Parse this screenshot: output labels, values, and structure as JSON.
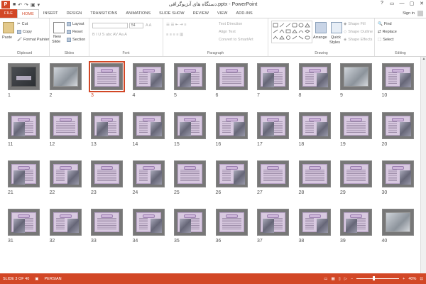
{
  "window": {
    "title": "دستگاه های آنژیوگرافی.pptx - PowerPoint",
    "app_badge": "P",
    "controls": [
      "?",
      "▭",
      "—",
      "▢",
      "✕"
    ]
  },
  "tabs": [
    {
      "label": "FILE"
    },
    {
      "label": "HOME"
    },
    {
      "label": "INSERT"
    },
    {
      "label": "DESIGN"
    },
    {
      "label": "TRANSITIONS"
    },
    {
      "label": "ANIMATIONS"
    },
    {
      "label": "SLIDE SHOW"
    },
    {
      "label": "REVIEW"
    },
    {
      "label": "VIEW"
    },
    {
      "label": "ADD-INS"
    }
  ],
  "signin": "Sign in",
  "ribbon": {
    "clipboard": {
      "label": "Clipboard",
      "paste": "Paste",
      "cut": "Cut",
      "copy": "Copy",
      "format_painter": "Format Painter"
    },
    "slides": {
      "label": "Slides",
      "new_slide": "New",
      "new_slide2": "Slide",
      "layout": "Layout",
      "reset": "Reset",
      "section": "Section"
    },
    "font": {
      "label": "Font",
      "size": "54"
    },
    "paragraph": {
      "label": "Paragraph",
      "text_direction": "Text Direction",
      "align_text": "Align Text",
      "smartart": "Convert to SmartArt"
    },
    "drawing": {
      "label": "Drawing",
      "arrange": "Arrange",
      "quick_styles": "Quick",
      "quick_styles2": "Styles",
      "shape_fill": "Shape Fill",
      "shape_outline": "Shape Outline",
      "shape_effects": "Shape Effects"
    },
    "editing": {
      "label": "Editing",
      "find": "Find",
      "replace": "Replace",
      "select": "Select"
    }
  },
  "slides": [
    {
      "n": "1",
      "kind": "title"
    },
    {
      "n": "2",
      "kind": "photo"
    },
    {
      "n": "3",
      "kind": "text",
      "selected": true
    },
    {
      "n": "4",
      "kind": "pic"
    },
    {
      "n": "5",
      "kind": "pic"
    },
    {
      "n": "6",
      "kind": "text"
    },
    {
      "n": "7",
      "kind": "pic"
    },
    {
      "n": "8",
      "kind": "pic"
    },
    {
      "n": "9",
      "kind": "photo"
    },
    {
      "n": "10",
      "kind": "pic"
    },
    {
      "n": "11",
      "kind": "pic"
    },
    {
      "n": "12",
      "kind": "text"
    },
    {
      "n": "13",
      "kind": "pic"
    },
    {
      "n": "14",
      "kind": "pic"
    },
    {
      "n": "15",
      "kind": "pic"
    },
    {
      "n": "16",
      "kind": "pic"
    },
    {
      "n": "17",
      "kind": "pic"
    },
    {
      "n": "18",
      "kind": "pic"
    },
    {
      "n": "19",
      "kind": "text"
    },
    {
      "n": "20",
      "kind": "pic"
    },
    {
      "n": "21",
      "kind": "pic"
    },
    {
      "n": "22",
      "kind": "pic"
    },
    {
      "n": "23",
      "kind": "text"
    },
    {
      "n": "24",
      "kind": "pic"
    },
    {
      "n": "25",
      "kind": "text"
    },
    {
      "n": "26",
      "kind": "pic"
    },
    {
      "n": "27",
      "kind": "text"
    },
    {
      "n": "28",
      "kind": "text"
    },
    {
      "n": "29",
      "kind": "text"
    },
    {
      "n": "30",
      "kind": "pic"
    },
    {
      "n": "31",
      "kind": "pic"
    },
    {
      "n": "32",
      "kind": "pic"
    },
    {
      "n": "33",
      "kind": "text"
    },
    {
      "n": "34",
      "kind": "pic"
    },
    {
      "n": "35",
      "kind": "pic"
    },
    {
      "n": "36",
      "kind": "text"
    },
    {
      "n": "37",
      "kind": "pic"
    },
    {
      "n": "38",
      "kind": "pic"
    },
    {
      "n": "39",
      "kind": "pic"
    },
    {
      "n": "40",
      "kind": "photo"
    }
  ],
  "status": {
    "slide": "SLIDE 3 OF 40",
    "language": "PERSIAN",
    "zoom": "40%",
    "zoom_fraction": 0.4
  },
  "colors": {
    "accent": "#d24726"
  }
}
